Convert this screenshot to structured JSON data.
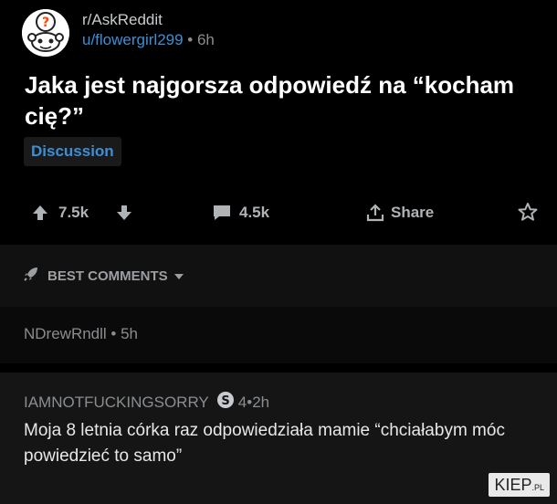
{
  "post": {
    "subreddit": "r/AskReddit",
    "username": "u/flowergirl299",
    "separator": " • ",
    "age": "6h",
    "title": "Jaka jest najgorsza odpowiedź na “kocham cię?”",
    "flair": "Discussion",
    "upvotes": "7.5k",
    "comments": "4.5k",
    "share_label": "Share"
  },
  "comments_header": {
    "label": "BEST COMMENTS"
  },
  "comments": [
    {
      "author": "NDrewRndll",
      "separator": " • ",
      "age": "5h"
    },
    {
      "author": "IAMNOTFUCKINGSORRY",
      "badge_count": "4",
      "separator": " • ",
      "age": "2h",
      "body": "Moja 8 letnia córka raz odpowiedziała mamie “chciałabym móc powiedzieć to samo”"
    }
  ],
  "watermark": {
    "main": "KIEP",
    "suffix": ".PL"
  },
  "colors": {
    "background": "#000000",
    "username": "#3c8fd6",
    "flair_text": "#3c8fd6",
    "muted": "#8a8d90"
  },
  "icons": [
    "avatar-snoo-question",
    "upvote-arrow-icon",
    "downvote-arrow-icon",
    "comment-bubble-icon",
    "share-icon",
    "award-icon",
    "rocket-icon",
    "chevron-down-icon",
    "silver-award-icon"
  ]
}
